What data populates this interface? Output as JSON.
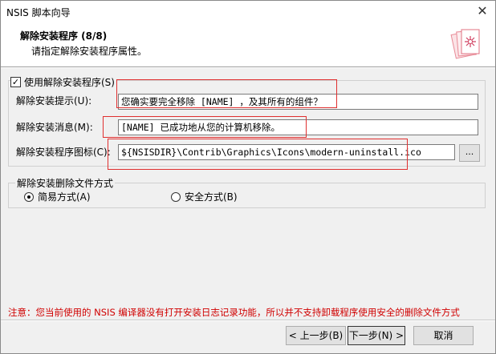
{
  "window": {
    "title": "NSIS 脚本向导",
    "close_glyph": "✕"
  },
  "header": {
    "title": "解除安装程序 (8/8)",
    "subtitle": "请指定解除安装程序属性。"
  },
  "options": {
    "use_uninstaller_label": "使用解除安装程序(S)",
    "use_uninstaller_checked": true,
    "prompt_label": "解除安装提示(U):",
    "prompt_value": "您确实要完全移除 [NAME] ，及其所有的组件？",
    "message_label": "解除安装消息(M):",
    "message_value": "[NAME] 已成功地从您的计算机移除。",
    "icon_label": "解除安装程序图标(C):",
    "icon_value": "${NSISDIR}\\Contrib\\Graphics\\Icons\\modern-uninstall.ico",
    "browse_label": "..."
  },
  "delete_mode": {
    "legend": "解除安装删除文件方式",
    "simple_label": "简易方式(A)",
    "safe_label": "安全方式(B)",
    "selected": "simple"
  },
  "note": "注意：您当前使用的 NSIS 编译器没有打开安装日志记录功能，所以并不支持卸载程序使用安全的删除文件方式",
  "buttons": {
    "back": "< 上一步(B)",
    "next": "下一步(N) >",
    "cancel": "取消"
  },
  "colors": {
    "annotation": "#e03030",
    "note_text": "#d00000"
  }
}
